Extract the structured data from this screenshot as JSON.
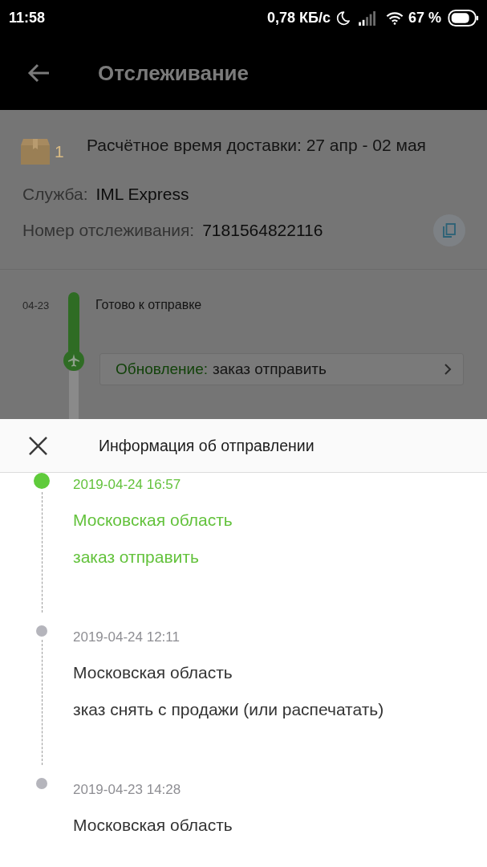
{
  "status_bar": {
    "time": "11:58",
    "network_speed": "0,78 КБ/с",
    "battery": "67 %"
  },
  "app_bar": {
    "title": "Отслеживание"
  },
  "shipment": {
    "package_count": "1",
    "delivery_estimate": "Расчётное время доставки: 27 апр - 02 мая",
    "fields": [
      {
        "label": "Служба:",
        "value": "IML Express",
        "copyable": false
      },
      {
        "label": "Номер отслеживания:",
        "value": "7181564822116",
        "copyable": true
      }
    ]
  },
  "progress": {
    "date": "04-23",
    "status": "Готово к отправке",
    "update": {
      "label": "Обновление:",
      "text": "заказ отправить"
    }
  },
  "sheet": {
    "title": "Информация об отправлении",
    "events": [
      {
        "time": "2019-04-24 16:57",
        "location": "Московская область",
        "description": "заказ отправить",
        "current": true
      },
      {
        "time": "2019-04-24 12:11",
        "location": "Московская область",
        "description": "зказ снять с продажи (или распечатать)",
        "current": false
      },
      {
        "time": "2019-04-23 14:28",
        "location": "Московская область",
        "current": false
      }
    ]
  }
}
